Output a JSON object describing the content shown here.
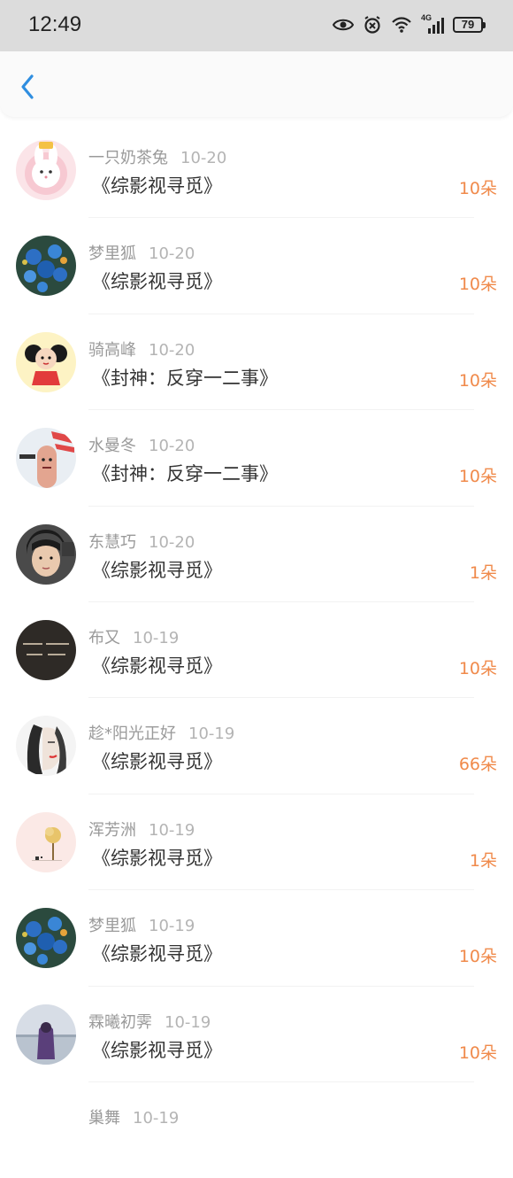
{
  "status_bar": {
    "time": "12:49",
    "battery": "79",
    "signal_label": "4G"
  },
  "colors": {
    "accent": "#2f8ee0",
    "amount": "#f08a4b",
    "name": "#9a9a9a"
  },
  "records": [
    {
      "name": "一只奶茶兔",
      "date": "10-20",
      "title": "《综影视寻觅》",
      "amount": "10朵",
      "avatar": "rabbit-cartoon"
    },
    {
      "name": "梦里狐",
      "date": "10-20",
      "title": "《综影视寻觅》",
      "amount": "10朵",
      "avatar": "blue-flowers"
    },
    {
      "name": "骑高峰",
      "date": "10-20",
      "title": "《封神：反穿一二事》",
      "amount": "10朵",
      "avatar": "cartoon-girl"
    },
    {
      "name": "水曼冬",
      "date": "10-20",
      "title": "《封神：反穿一二事》",
      "amount": "10朵",
      "avatar": "finger-meme"
    },
    {
      "name": "东慧巧",
      "date": "10-20",
      "title": "《综影视寻觅》",
      "amount": "1朵",
      "avatar": "boy-photo"
    },
    {
      "name": "布又",
      "date": "10-19",
      "title": "《综影视寻觅》",
      "amount": "10朵",
      "avatar": "dark-text"
    },
    {
      "name": "趁*阳光正好",
      "date": "10-19",
      "title": "《综影视寻觅》",
      "amount": "66朵",
      "avatar": "sketch-woman"
    },
    {
      "name": "浑芳洲",
      "date": "10-19",
      "title": "《综影视寻觅》",
      "amount": "1朵",
      "avatar": "pink-tree"
    },
    {
      "name": "梦里狐",
      "date": "10-19",
      "title": "《综影视寻觅》",
      "amount": "10朵",
      "avatar": "blue-flowers"
    },
    {
      "name": "霖曦初霁",
      "date": "10-19",
      "title": "《综影视寻觅》",
      "amount": "10朵",
      "avatar": "girl-seaside"
    },
    {
      "name": "巢舞",
      "date": "10-19",
      "title": "",
      "amount": "",
      "avatar": "none"
    }
  ]
}
